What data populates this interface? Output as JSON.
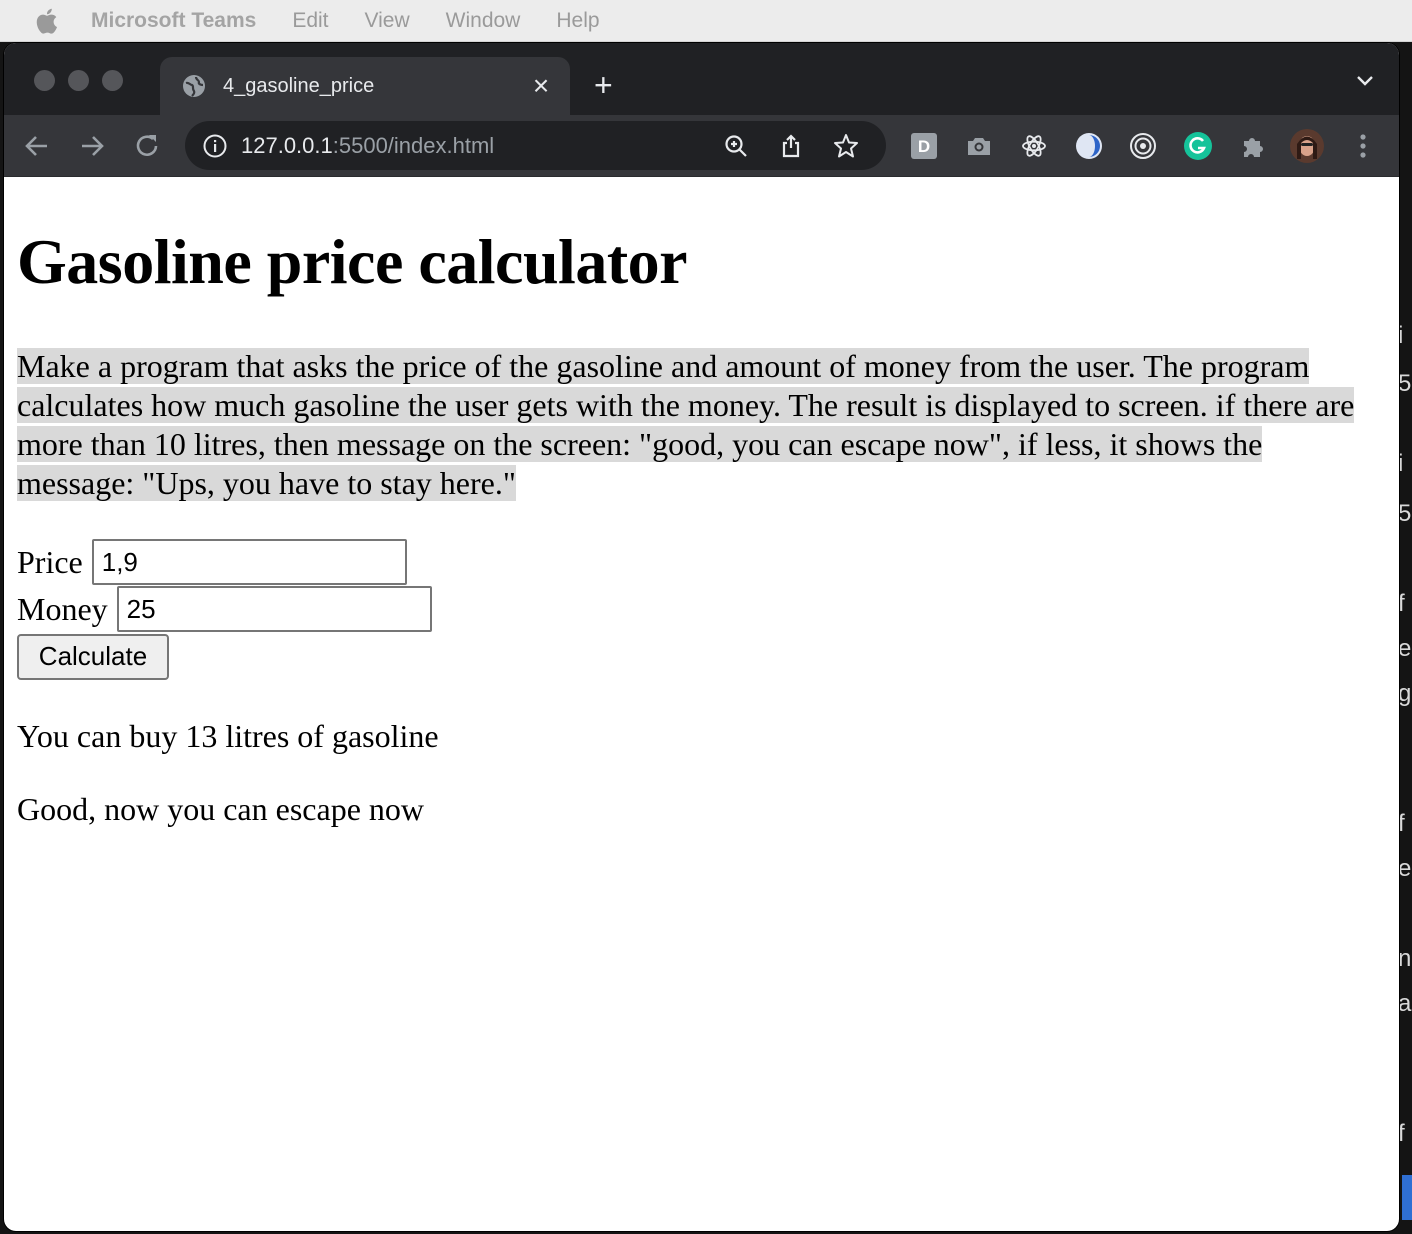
{
  "menubar": {
    "app_name": "Microsoft Teams",
    "items": [
      "Edit",
      "View",
      "Window",
      "Help"
    ]
  },
  "browser": {
    "tab_title": "4_gasoline_price",
    "url_host": "127.0.0.1",
    "url_path": ":5500/index.html",
    "extension_letter": "D"
  },
  "page": {
    "title": "Gasoline price calculator",
    "description": "Make a program that asks the price of the gasoline and amount of money from the user. The program calculates how much gasoline the user gets with the money. The result is displayed to screen. if there are more than 10 litres, then message on the screen: \"good, you can escape now\", if less, it shows the message: \"Ups, you have to stay here.\"",
    "price_label": "Price",
    "price_value": "1,9",
    "money_label": "Money",
    "money_value": "25",
    "button_label": "Calculate",
    "result_text": "You can buy 13 litres of gasoline",
    "message_text": "Good, now you can escape now"
  },
  "colors": {
    "tab_strip": "#202124",
    "toolbar": "#35363a",
    "highlight": "#d9d9d9"
  }
}
